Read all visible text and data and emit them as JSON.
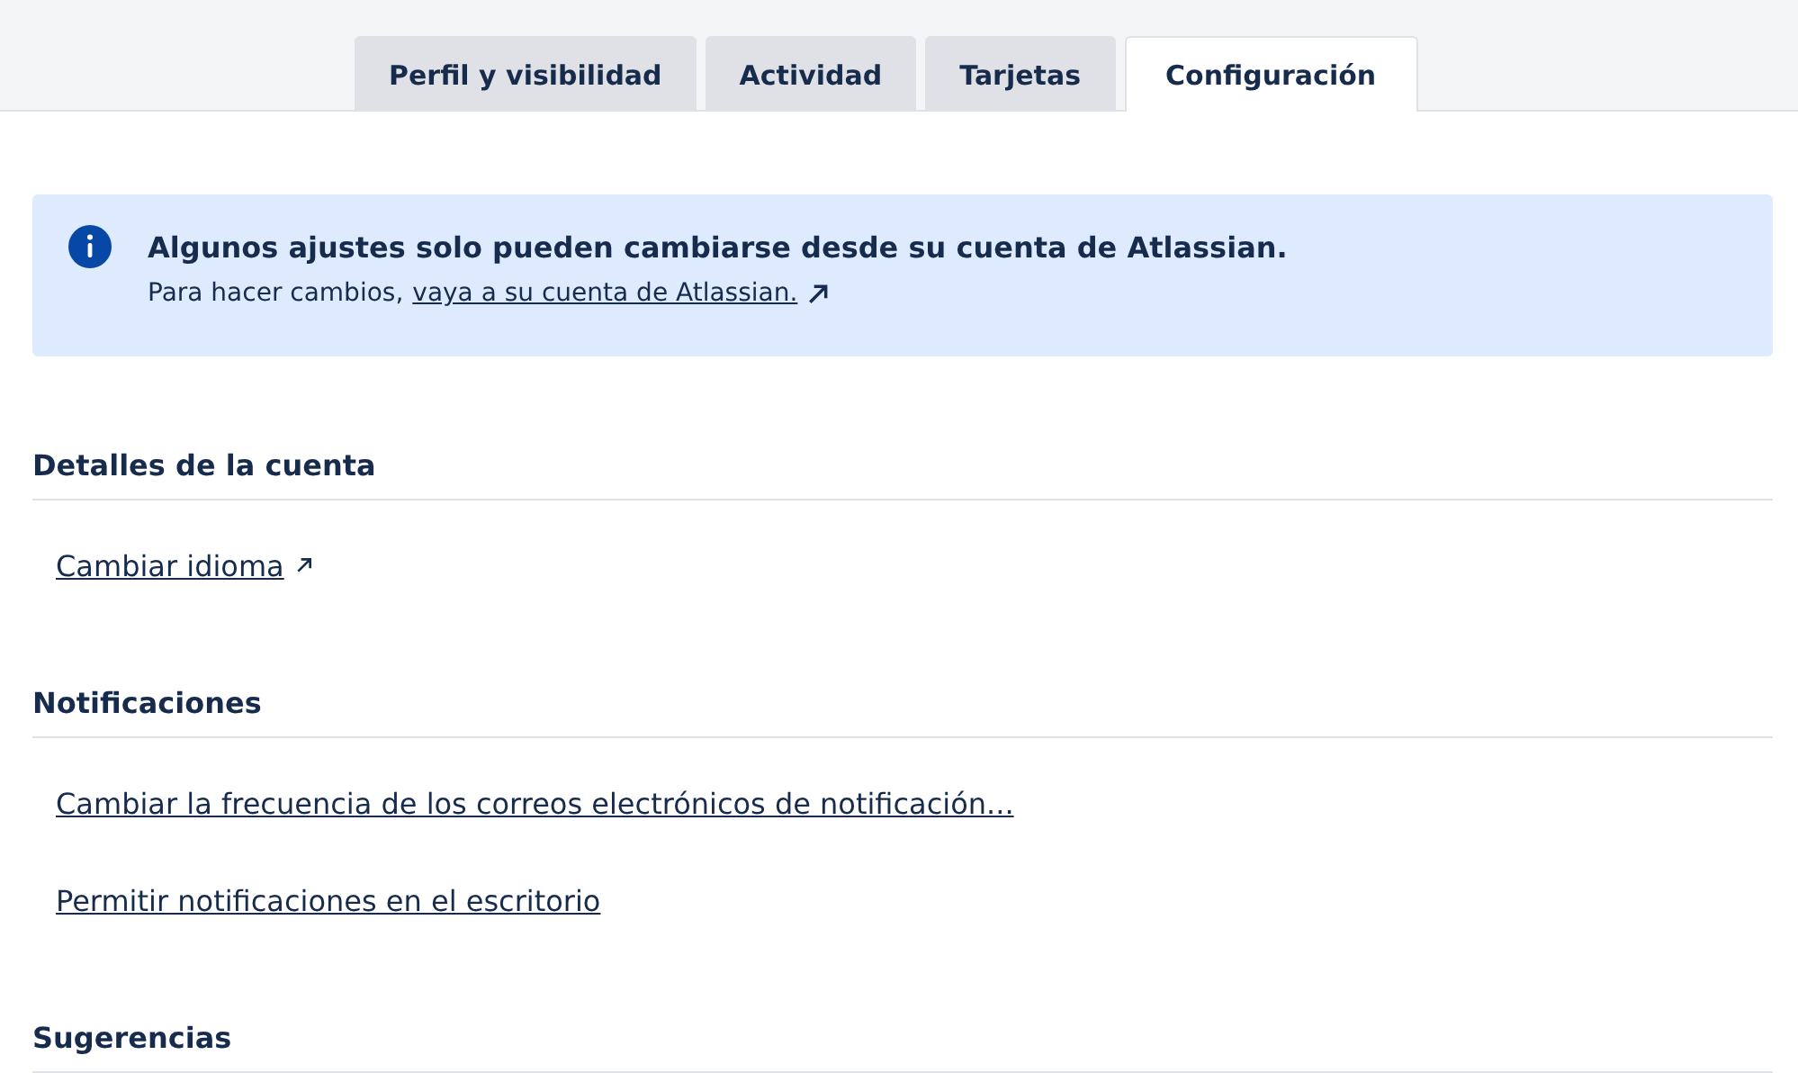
{
  "tabs": [
    {
      "label": "Perfil y visibilidad",
      "selected": false
    },
    {
      "label": "Actividad",
      "selected": false
    },
    {
      "label": "Tarjetas",
      "selected": false
    },
    {
      "label": "Configuración",
      "selected": true
    }
  ],
  "banner": {
    "title": "Algunos ajustes solo pueden cambiarse desde su cuenta de Atlassian.",
    "text": "Para hacer cambios,",
    "link": "vaya a su cuenta de Atlassian."
  },
  "sections": [
    {
      "heading": "Detalles de la cuenta",
      "links": [
        {
          "label": "Cambiar idioma",
          "external": true
        }
      ]
    },
    {
      "heading": "Notificaciones",
      "links": [
        {
          "label": "Cambiar la frecuencia de los correos electrónicos de notificación...",
          "external": false
        },
        {
          "label": "Permitir notificaciones en el escritorio",
          "external": false
        }
      ]
    },
    {
      "heading": "Sugerencias"
    }
  ]
}
